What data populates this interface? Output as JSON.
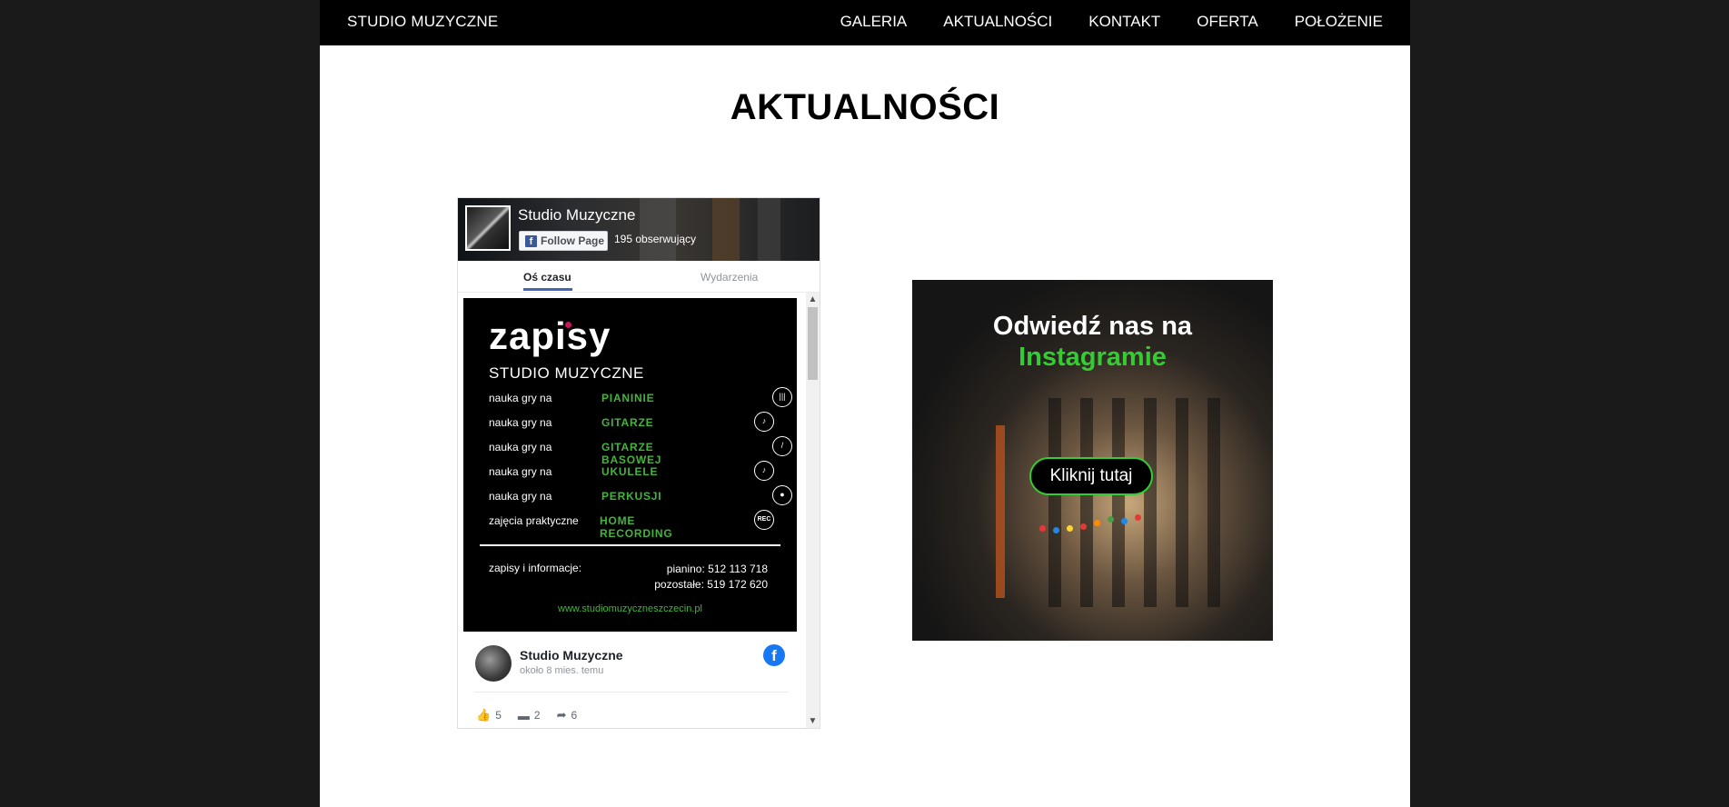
{
  "brand": "STUDIO MUZYCZNE",
  "nav": [
    "GALERIA",
    "AKTUALNOŚCI",
    "KONTAKT",
    "OFERTA",
    "POŁOŻENIE"
  ],
  "page_title": "AKTUALNOŚCI",
  "facebook": {
    "page_name": "Studio Muzyczne",
    "follow_label": "Follow Page",
    "followers": "195 obserwujący",
    "tabs": [
      "Oś czasu",
      "Wydarzenia"
    ],
    "post_image": {
      "headline": "zapisy",
      "subtitle": "STUDIO MUZYCZNE",
      "rows": [
        {
          "label": "nauka gry na",
          "value": "PIANINIE",
          "icon": "piano-icon"
        },
        {
          "label": "nauka gry na",
          "value": "GITARZE",
          "icon": "guitar-icon"
        },
        {
          "label": "nauka gry na",
          "value": "GITARZE BASOWEJ",
          "icon": "bass-guitar-icon"
        },
        {
          "label": "nauka gry na",
          "value": "UKULELE",
          "icon": "ukulele-icon"
        },
        {
          "label": "nauka gry na",
          "value": "PERKUSJI",
          "icon": "drums-icon"
        },
        {
          "label": "zajęcia praktyczne",
          "value": "HOME RECORDING",
          "icon": "rec-icon"
        }
      ],
      "rec_text": "REC",
      "info_label": "zapisy i informacje:",
      "phone_piano": "pianino:    512 113 718",
      "phone_other": "pozostałe: 519 172 620",
      "website": "www.studiomuzyczneszczecin.pl"
    },
    "post_author": "Studio Muzyczne",
    "post_time": "około 8 mies. temu",
    "likes": "5",
    "comments": "2",
    "shares": "6"
  },
  "instagram": {
    "line1": "Odwiedź nas na",
    "line2": "Instagramie",
    "button": "Kliknij tutaj"
  },
  "colors": {
    "accent_green": "#33cc33",
    "fb_blue": "#4267b2"
  }
}
